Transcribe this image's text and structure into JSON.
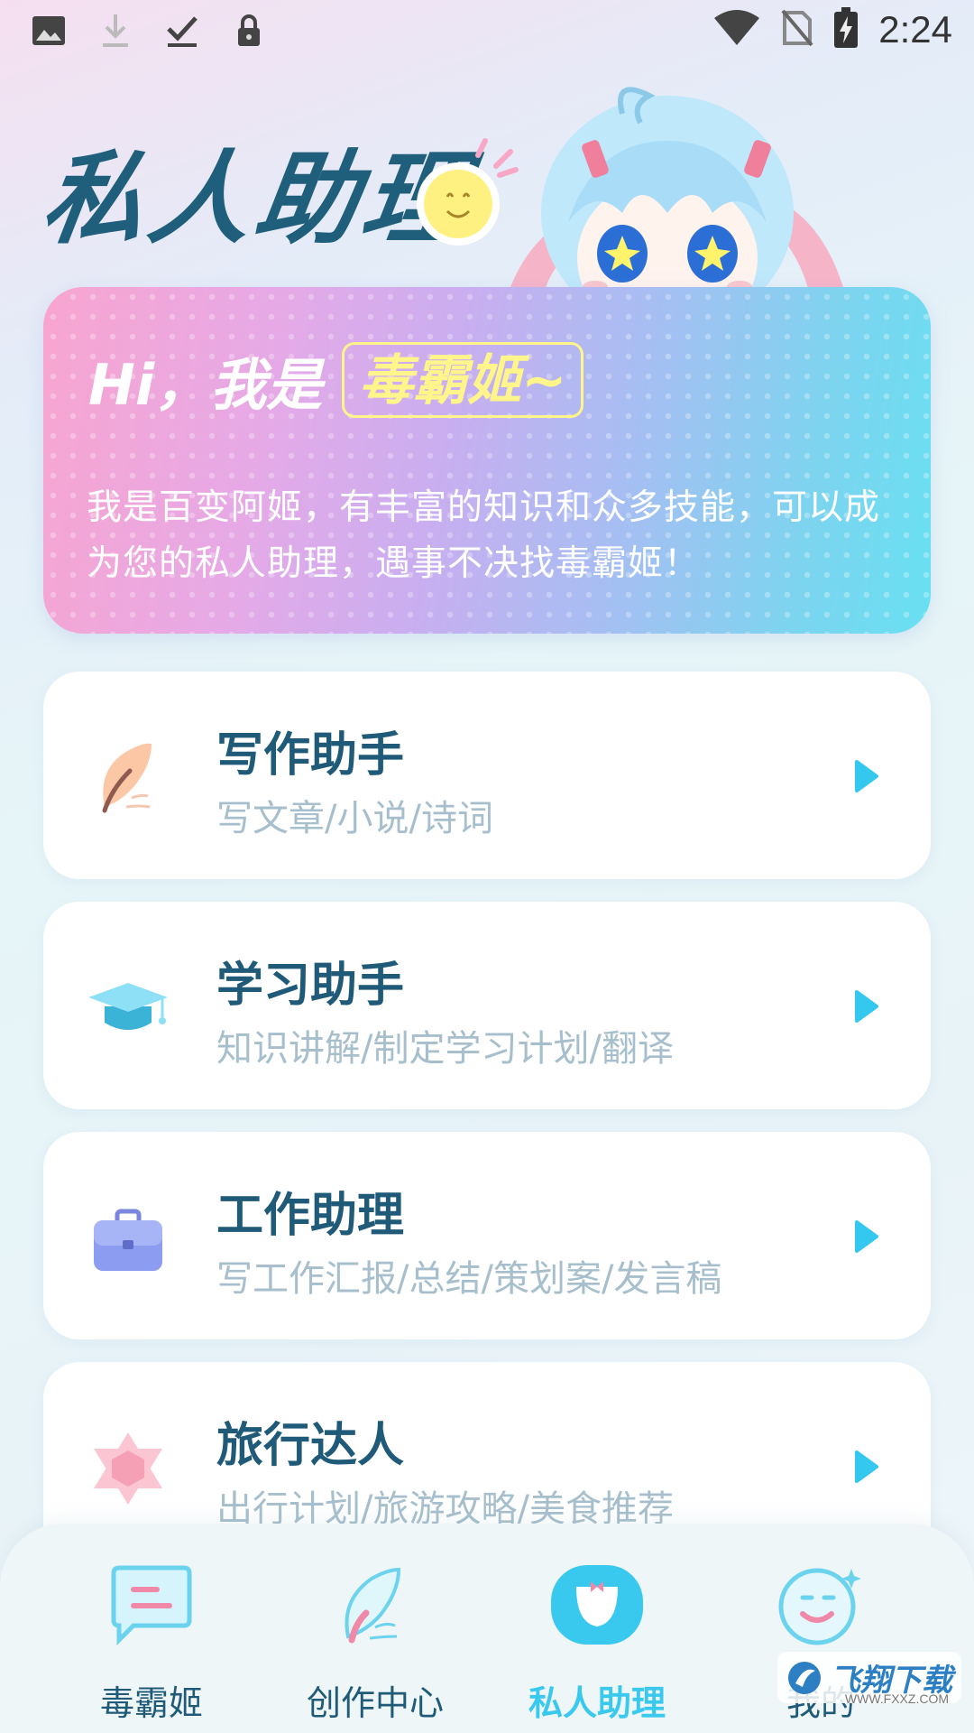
{
  "status_bar": {
    "time": "2:24",
    "left_icons": [
      "image-icon",
      "download-icon",
      "download-done-icon",
      "lock-icon"
    ],
    "right_icons": [
      "wifi-icon",
      "no-sim-icon",
      "battery-charging-icon"
    ]
  },
  "header": {
    "title": "私人助理"
  },
  "hero": {
    "greeting": "Hi，我是",
    "name": "毒霸姬~",
    "description": "我是百变阿姬，有丰富的知识和众多技能，可以成为您的私人助理，遇事不决找毒霸姬！"
  },
  "cards": [
    {
      "title": "写作助手",
      "subtitle": "写文章/小说/诗词",
      "icon": "feather-pen-icon"
    },
    {
      "title": "学习助手",
      "subtitle": "知识讲解/制定学习计划/翻译",
      "icon": "graduation-cap-icon"
    },
    {
      "title": "工作助理",
      "subtitle": "写工作汇报/总结/策划案/发言稿",
      "icon": "briefcase-icon"
    },
    {
      "title": "旅行达人",
      "subtitle": "出行计划/旅游攻略/美食推荐",
      "icon": "hexagram-icon"
    }
  ],
  "bottom_nav": {
    "items": [
      {
        "label": "毒霸姬",
        "icon": "chat-icon",
        "active": false
      },
      {
        "label": "创作中心",
        "icon": "feather-icon",
        "active": false
      },
      {
        "label": "私人助理",
        "icon": "assistant-icon",
        "active": true
      },
      {
        "label": "我的",
        "icon": "smile-face-icon",
        "active": false
      }
    ]
  },
  "watermark": {
    "text": "飞翔下载",
    "url": "WWW.FXXZ.COM"
  },
  "colors": {
    "accent": "#3ac9ee",
    "title": "#1f5a78",
    "subtitle": "#a7bfcd",
    "name_highlight": "#fff58a"
  }
}
